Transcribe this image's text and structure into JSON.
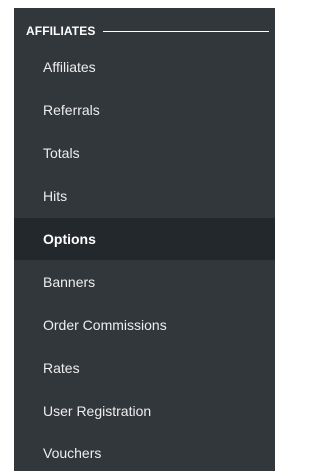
{
  "sidebar": {
    "section_title": "AFFILIATES",
    "items": [
      {
        "label": "Affiliates"
      },
      {
        "label": "Referrals"
      },
      {
        "label": "Totals"
      },
      {
        "label": "Hits"
      },
      {
        "label": "Options"
      },
      {
        "label": "Banners"
      },
      {
        "label": "Order Commissions"
      },
      {
        "label": "Rates"
      },
      {
        "label": "User Registration"
      },
      {
        "label": "Vouchers"
      }
    ],
    "active_item": "Options"
  }
}
